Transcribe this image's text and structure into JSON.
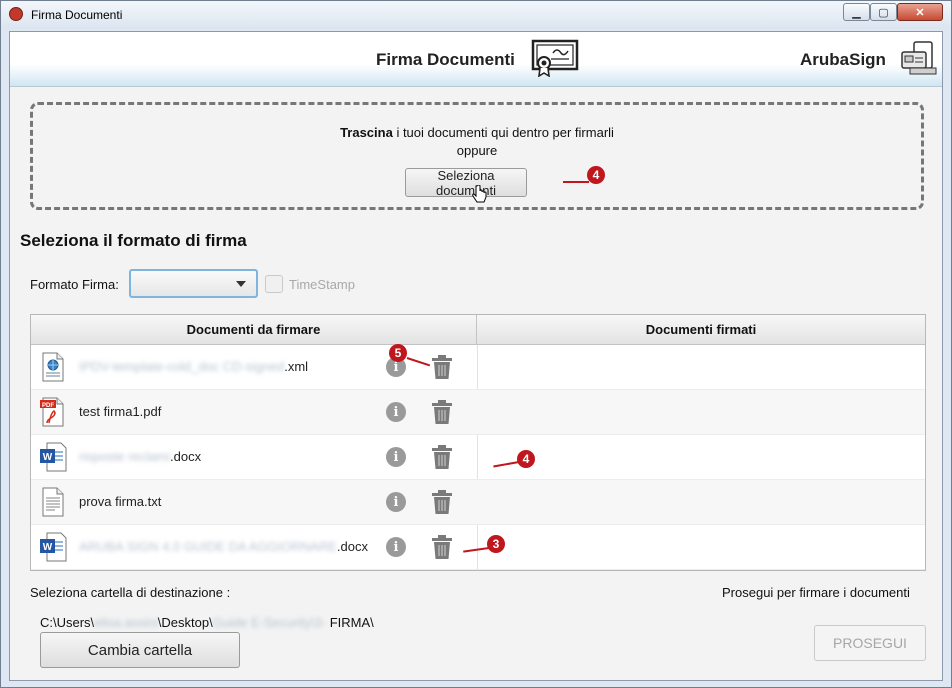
{
  "window": {
    "title": "Firma Documenti",
    "controls": {
      "minimize": "▁",
      "maximize": "▢",
      "close": "✕"
    }
  },
  "header": {
    "title": "Firma Documenti",
    "brand": "ArubaSign",
    "icons": [
      "certificate-icon",
      "arubasign-card-icon"
    ]
  },
  "dropzone": {
    "bold": "Trascina",
    "text": " i tuoi documenti qui dentro per firmarli",
    "or": "oppure",
    "button_label": "Seleziona documenti"
  },
  "format": {
    "section_title": "Seleziona il formato di firma",
    "label": "Formato Firma:",
    "selected": "",
    "timestamp_label": "TimeStamp",
    "timestamp_checked": false
  },
  "table": {
    "headers": [
      "Documenti da firmare",
      "Documenti firmati"
    ],
    "rows": [
      {
        "blurred": "IPDV-template-cold_doc CD-signed",
        "visible": ".xml",
        "icon": "xml-file-icon"
      },
      {
        "blurred": "",
        "visible": "test firma1.pdf",
        "icon": "pdf-file-icon"
      },
      {
        "blurred": "risposte reclami",
        "visible": ".docx",
        "icon": "word-file-icon"
      },
      {
        "blurred": "",
        "visible": "prova firma.txt",
        "icon": "text-file-icon"
      },
      {
        "blurred": "ARUBA SIGN 4.0 GUIDE DA AGGIORNARE",
        "visible": ".docx",
        "icon": "word-file-icon"
      }
    ]
  },
  "annotations": [
    "4",
    "5",
    "4",
    "3"
  ],
  "bottom": {
    "dest_label": "Seleziona cartella di destinazione :",
    "proceed_label": "Prosegui per firmare i documenti",
    "path_a": "C:\\Users\\",
    "path_b": "elisa.assini",
    "path_c": "\\Desktop\\",
    "path_d": "Guide E-Security\\3-",
    "path_e": " FIRMA\\",
    "change_button": "Cambia cartella",
    "proceed_button": "PROSEGUI"
  },
  "colors": {
    "accent": "#7fb4de",
    "annotation": "#c0161d",
    "header_gradient": "#cfe6f2"
  }
}
